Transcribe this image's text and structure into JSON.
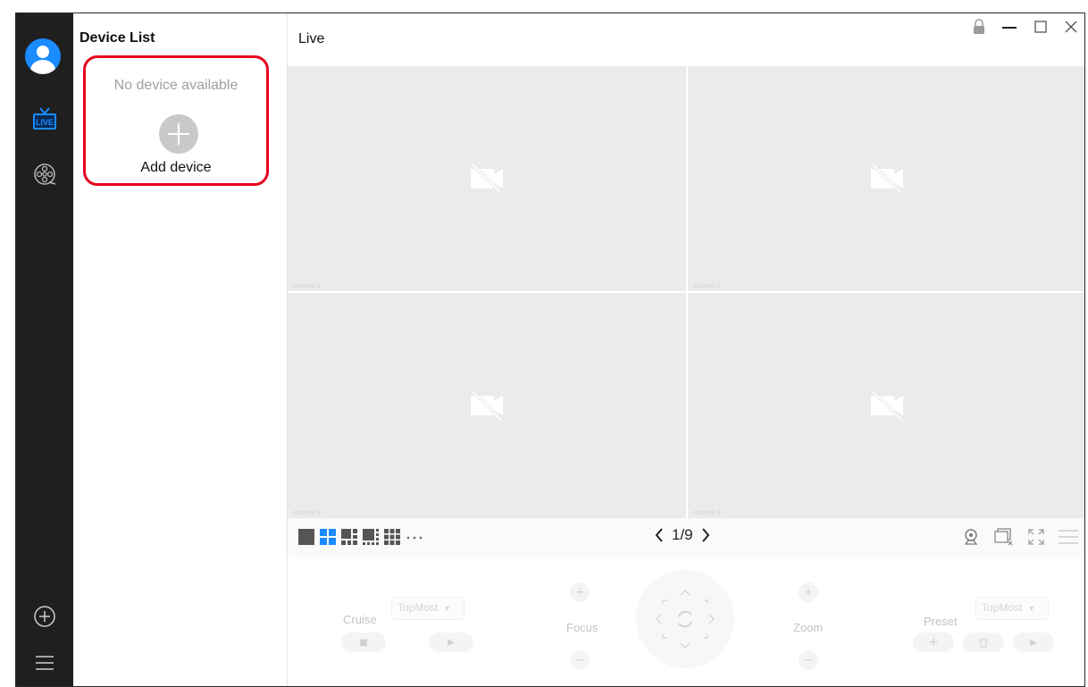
{
  "sidebar": {
    "items": [
      {
        "name": "live",
        "icon": "live-tv-icon",
        "active": true
      },
      {
        "name": "playback",
        "icon": "film-reel-icon",
        "active": false
      }
    ],
    "bottom": [
      {
        "icon": "add-circle-icon"
      },
      {
        "icon": "menu-icon"
      }
    ],
    "accent": "#1a8cff"
  },
  "device_panel": {
    "title": "Device List",
    "empty_text": "No device available",
    "add_label": "Add device",
    "highlight_color": "#e8001c"
  },
  "live": {
    "title": "Live",
    "window_controls": [
      "lock-icon",
      "minimize-icon",
      "maximize-icon",
      "close-icon"
    ],
    "cameras": [
      {
        "label": "Camera 1"
      },
      {
        "label": "Camera 2"
      },
      {
        "label": "Camera 3"
      },
      {
        "label": "Camera 4"
      }
    ],
    "pager": {
      "text": "1/9"
    },
    "layout_options": [
      "1-split",
      "4-split",
      "6-split",
      "8-split",
      "9-split",
      "more"
    ],
    "selected_layout": "4-split"
  },
  "ptz": {
    "cruise_label": "Cruise",
    "cruise_select": "TopMost",
    "focus_label": "Focus",
    "zoom_label": "Zoom",
    "preset_label": "Preset",
    "preset_select": "TopMost"
  }
}
